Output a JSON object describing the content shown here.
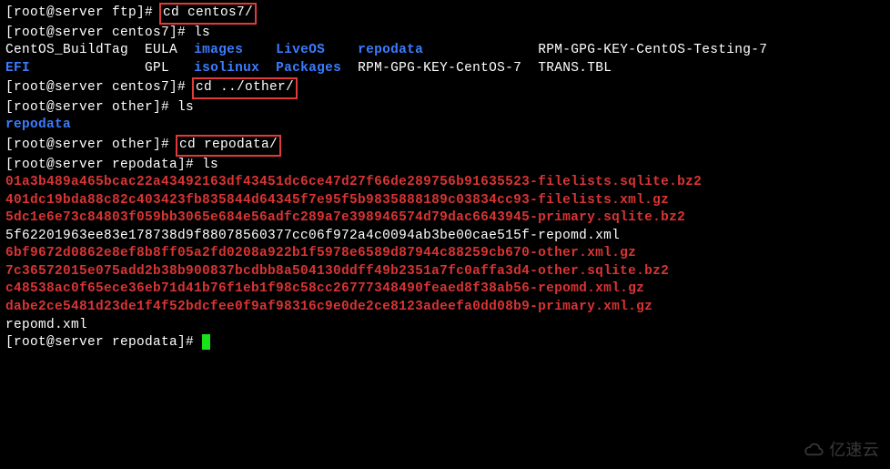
{
  "prompts": {
    "ftp": "[root@server ftp]# ",
    "centos7": "[root@server centos7]# ",
    "other": "[root@server other]# ",
    "repodata": "[root@server repodata]# "
  },
  "cmds": {
    "cd_centos7": "cd centos7/",
    "ls": "ls",
    "cd_other": "cd ../other/",
    "cd_repodata": "cd repodata/"
  },
  "ls_centos7": {
    "row1": {
      "c1": "CentOS_BuildTag",
      "c2": "EULA",
      "c3": "images",
      "c4": "LiveOS",
      "c5": "repodata",
      "c6": "RPM-GPG-KEY-CentOS-Testing-7"
    },
    "row2": {
      "c1": "EFI",
      "c2": "GPL",
      "c3": "isolinux",
      "c4": "Packages",
      "c5": "RPM-GPG-KEY-CentOS-7",
      "c6": "TRANS.TBL"
    }
  },
  "ls_other": {
    "item1": "repodata"
  },
  "ls_repodata": {
    "f1": "01a3b489a465bcac22a43492163df43451dc6ce47d27f66de289756b91635523-filelists.sqlite.bz2",
    "f2": "401dc19bda88c82c403423fb835844d64345f7e95f5b9835888189c03834cc93-filelists.xml.gz",
    "f3": "5dc1e6e73c84803f059bb3065e684e56adfc289a7e398946574d79dac6643945-primary.sqlite.bz2",
    "f4": "5f62201963ee83e178738d9f88078560377cc06f972a4c0094ab3be00cae515f-repomd.xml",
    "f5": "6bf9672d0862e8ef8b8ff05a2fd0208a922b1f5978e6589d87944c88259cb670-other.xml.gz",
    "f6": "7c36572015e075add2b38b900837bcdbb8a504130ddff49b2351a7fc0affa3d4-other.sqlite.bz2",
    "f7": "c48538ac0f65ece36eb71d41b76f1eb1f98c58cc26777348490feaed8f38ab56-repomd.xml.gz",
    "f8": "dabe2ce5481d23de1f4f52bdcfee0f9af98316c9e0de2ce8123adeefa0dd08b9-primary.xml.gz",
    "f9": "repomd.xml"
  },
  "watermark": {
    "text": "亿速云"
  }
}
